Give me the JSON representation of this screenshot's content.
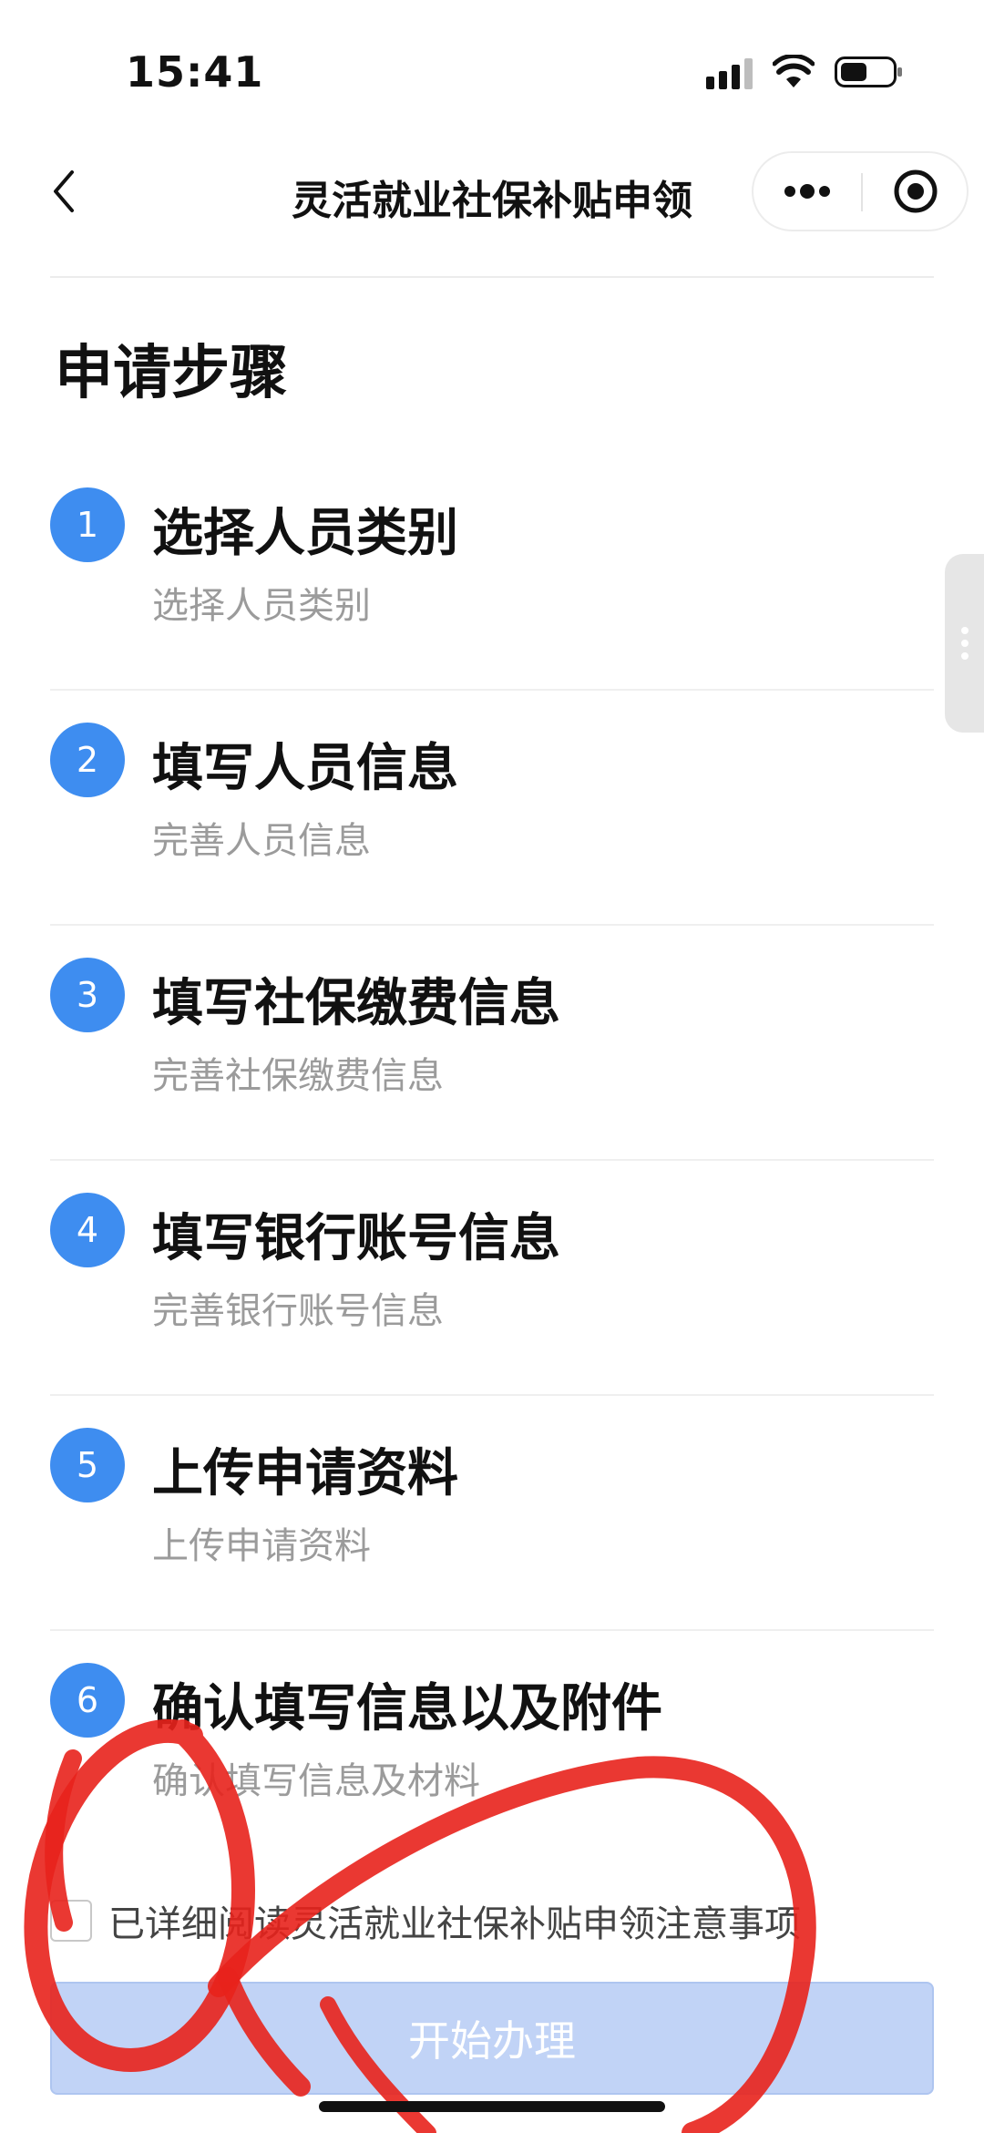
{
  "status_bar": {
    "time": "15:41"
  },
  "nav": {
    "title": "灵活就业社保补贴申领"
  },
  "section": {
    "title": "申请步骤"
  },
  "steps": [
    {
      "num": "1",
      "title": "选择人员类别",
      "subtitle": "选择人员类别"
    },
    {
      "num": "2",
      "title": "填写人员信息",
      "subtitle": "完善人员信息"
    },
    {
      "num": "3",
      "title": "填写社保缴费信息",
      "subtitle": "完善社保缴费信息"
    },
    {
      "num": "4",
      "title": "填写银行账号信息",
      "subtitle": "完善银行账号信息"
    },
    {
      "num": "5",
      "title": "上传申请资料",
      "subtitle": "上传申请资料"
    },
    {
      "num": "6",
      "title": "确认填写信息以及附件",
      "subtitle": "确认填写信息及材料"
    }
  ],
  "agreement": {
    "checked": false,
    "text": "已详细阅读灵活就业社保补贴申领注意事项"
  },
  "primary_button": {
    "label": "开始办理",
    "enabled": false
  },
  "colors": {
    "accent": "#3e8df0",
    "button_disabled": "#c1d3f6",
    "annotation": "#e8221c"
  },
  "icons": [
    "signal-icon",
    "wifi-icon",
    "battery-icon",
    "back-icon",
    "more-icon",
    "close-circle-icon",
    "handle-dots-icon"
  ]
}
